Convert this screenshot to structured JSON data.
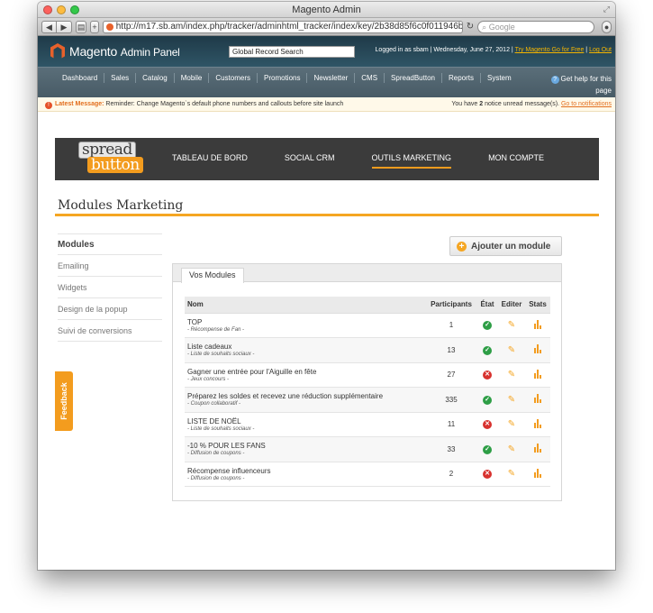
{
  "browser": {
    "title": "Magento Admin",
    "url": "http://m17.sb.am/index.php/tracker/adminhtml_tracker/index/key/2b38d85f6c0f011946b210f",
    "search_placeholder": "Google"
  },
  "magento": {
    "logo_text": "Magento",
    "logo_sub": "Admin Panel",
    "global_search": "Global Record Search",
    "user_info": "Logged in as sbam | Wednesday, June 27, 2012 |",
    "try_link": "Try Magento Go for Free",
    "logout_link": "Log Out",
    "nav": [
      "Dashboard",
      "Sales",
      "Catalog",
      "Mobile",
      "Customers",
      "Promotions",
      "Newsletter",
      "CMS",
      "SpreadButton",
      "Reports",
      "System"
    ],
    "help_line1": "Get help for this",
    "help_line2": "page",
    "message_label": "Latest Message:",
    "message_text": "Reminder: Change Magento`s default phone numbers and callouts before site launch",
    "notice_prefix": "You have",
    "notice_count": "2",
    "notice_suffix": "notice unread message(s).",
    "notice_link": "Go to notifications"
  },
  "spreadbutton": {
    "logo_top": "spread",
    "logo_bottom": "button",
    "menu": [
      "TABLEAU DE BORD",
      "SOCIAL CRM",
      "OUTILS MARKETING",
      "MON COMPTE"
    ],
    "active_menu": "OUTILS MARKETING",
    "page_title": "Modules Marketing",
    "sidebar": [
      "Modules",
      "Emailing",
      "Widgets",
      "Design de la popup",
      "Suivi de conversions"
    ],
    "feedback": "Feedback",
    "add_button": "Ajouter un module",
    "panel_tab": "Vos Modules",
    "table_headers": {
      "name": "Nom",
      "participants": "Participants",
      "state": "État",
      "edit": "Editer",
      "stats": "Stats"
    },
    "modules": [
      {
        "name": "TOP",
        "type": "- Récompense de Fan -",
        "participants": "1",
        "state": "ok"
      },
      {
        "name": "Liste cadeaux",
        "type": "- Liste de souhaits sociaux -",
        "participants": "13",
        "state": "ok"
      },
      {
        "name": "Gagner une entrée pour l'Aiguille en fête",
        "type": "- Jeux concours -",
        "participants": "27",
        "state": "ko"
      },
      {
        "name": "Préparez les soldes et recevez une réduction supplémentaire",
        "type": "- Coupon collaboratif -",
        "participants": "335",
        "state": "ok"
      },
      {
        "name": "LISTE DE NOËL",
        "type": "- Liste de souhaits sociaux -",
        "participants": "11",
        "state": "ko"
      },
      {
        "name": "-10 % POUR LES FANS",
        "type": "- Diffusion de coupons -",
        "participants": "33",
        "state": "ok"
      },
      {
        "name": "Récompense influenceurs",
        "type": "- Diffusion de coupons -",
        "participants": "2",
        "state": "ko"
      }
    ]
  },
  "colors": {
    "accent": "#f39c1e",
    "ok": "#2e9e46",
    "ko": "#d8322f",
    "header_dark": "#3b3b3b"
  }
}
